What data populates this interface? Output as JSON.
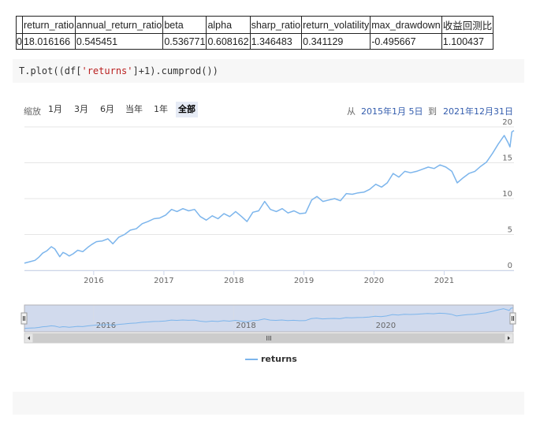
{
  "metrics_table": {
    "headers": [
      "",
      "return_ratio",
      "annual_return_ratio",
      "beta",
      "alpha",
      "sharp_ratio",
      "return_volatility",
      "max_drawdown",
      "收益回测比"
    ],
    "rows": [
      [
        "0",
        "18.016166",
        "0.545451",
        "0.536771",
        "0.608162",
        "1.346483",
        "0.341129",
        "-0.495667",
        "1.100437"
      ]
    ]
  },
  "code": {
    "prefix": "T.plot((df[",
    "string": "'returns'",
    "suffix": "]+1).cumprod())"
  },
  "range_selector": {
    "zoom_label": "缩放",
    "buttons": [
      "1月",
      "3月",
      "6月",
      "当年",
      "1年",
      "全部"
    ],
    "active": "全部",
    "from_label": "从",
    "from_date": "2015年1月 5日",
    "to_label": "到",
    "to_date": "2021年12月31日"
  },
  "navigator_scrollbar_grip": "III",
  "colors": {
    "series": "#7cb5ec",
    "grid": "#e6e6e6",
    "navigator_mask": "rgba(102,133,194,0.3)",
    "active_button": "#e6ebf5",
    "date_text": "#335cad"
  },
  "chart_data": {
    "type": "line",
    "x_axis": {
      "type": "date",
      "labels": [
        "2016",
        "2017",
        "2018",
        "2019",
        "2020",
        "2021"
      ]
    },
    "y_axis": {
      "labels": [
        "0",
        "5",
        "10",
        "15",
        "20"
      ],
      "min": 0,
      "max": 20,
      "position": "right"
    },
    "navigator_labels": [
      "2016",
      "2018",
      "2020"
    ],
    "legend": [
      "returns"
    ],
    "series": [
      {
        "name": "returns",
        "x": [
          "2015-01-05",
          "2015-02-01",
          "2015-03-01",
          "2015-03-20",
          "2015-04-10",
          "2015-05-01",
          "2015-05-25",
          "2015-06-12",
          "2015-07-08",
          "2015-07-25",
          "2015-08-10",
          "2015-08-26",
          "2015-09-15",
          "2015-10-10",
          "2015-11-05",
          "2015-12-01",
          "2015-12-22",
          "2016-01-15",
          "2016-02-15",
          "2016-03-15",
          "2016-04-10",
          "2016-05-10",
          "2016-06-10",
          "2016-07-10",
          "2016-08-10",
          "2016-09-10",
          "2016-10-10",
          "2016-11-10",
          "2016-12-10",
          "2017-01-10",
          "2017-02-10",
          "2017-03-10",
          "2017-04-10",
          "2017-05-10",
          "2017-06-10",
          "2017-07-10",
          "2017-08-10",
          "2017-09-10",
          "2017-10-10",
          "2017-11-10",
          "2017-12-10",
          "2018-01-10",
          "2018-02-10",
          "2018-03-10",
          "2018-04-10",
          "2018-05-10",
          "2018-06-10",
          "2018-07-10",
          "2018-08-10",
          "2018-09-10",
          "2018-10-10",
          "2018-11-10",
          "2018-12-10",
          "2019-01-10",
          "2019-02-10",
          "2019-03-10",
          "2019-04-10",
          "2019-05-10",
          "2019-06-10",
          "2019-07-10",
          "2019-08-10",
          "2019-09-10",
          "2019-10-10",
          "2019-11-10",
          "2019-12-10",
          "2020-01-10",
          "2020-02-10",
          "2020-03-10",
          "2020-04-10",
          "2020-05-10",
          "2020-06-10",
          "2020-07-10",
          "2020-08-10",
          "2020-09-10",
          "2020-10-10",
          "2020-11-10",
          "2020-12-10",
          "2021-01-10",
          "2021-02-10",
          "2021-03-10",
          "2021-04-10",
          "2021-05-10",
          "2021-06-10",
          "2021-07-10",
          "2021-08-10",
          "2021-09-10",
          "2021-10-10",
          "2021-11-10",
          "2021-11-30",
          "2021-12-10",
          "2021-12-20",
          "2021-12-31"
        ],
        "y": [
          1.0,
          1.2,
          1.4,
          1.8,
          2.4,
          2.7,
          3.3,
          3.0,
          1.9,
          2.5,
          2.3,
          2.0,
          2.3,
          2.8,
          2.6,
          3.2,
          3.6,
          4.0,
          4.1,
          4.4,
          3.7,
          4.6,
          5.0,
          5.6,
          5.8,
          6.5,
          6.8,
          7.2,
          7.3,
          7.7,
          8.5,
          8.2,
          8.6,
          8.3,
          8.5,
          7.5,
          7.0,
          7.6,
          7.2,
          7.9,
          7.5,
          8.2,
          7.5,
          6.8,
          8.1,
          8.3,
          9.6,
          8.5,
          8.2,
          8.6,
          8.0,
          8.3,
          7.9,
          8.0,
          9.8,
          10.3,
          9.6,
          9.8,
          10.0,
          9.7,
          10.7,
          10.6,
          10.8,
          10.9,
          11.3,
          12.0,
          11.6,
          12.2,
          13.5,
          13.0,
          13.8,
          13.6,
          13.8,
          14.1,
          14.4,
          14.2,
          14.7,
          14.4,
          13.8,
          12.2,
          12.9,
          13.5,
          13.8,
          14.5,
          15.1,
          16.3,
          17.6,
          18.8,
          17.8,
          17.2,
          19.3,
          19.5
        ]
      }
    ]
  }
}
